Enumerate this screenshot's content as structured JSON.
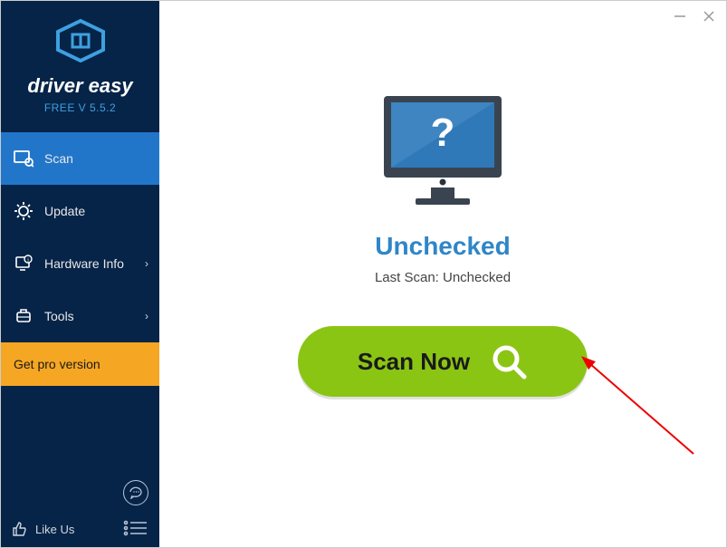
{
  "brand": {
    "name": "driver easy",
    "version": "FREE V 5.5.2"
  },
  "nav": {
    "scan": "Scan",
    "update": "Update",
    "hardware": "Hardware Info",
    "tools": "Tools",
    "pro": "Get pro version"
  },
  "footer": {
    "like": "Like Us"
  },
  "main": {
    "status_title": "Unchecked",
    "status_sub": "Last Scan: Unchecked",
    "scan_button": "Scan Now"
  }
}
